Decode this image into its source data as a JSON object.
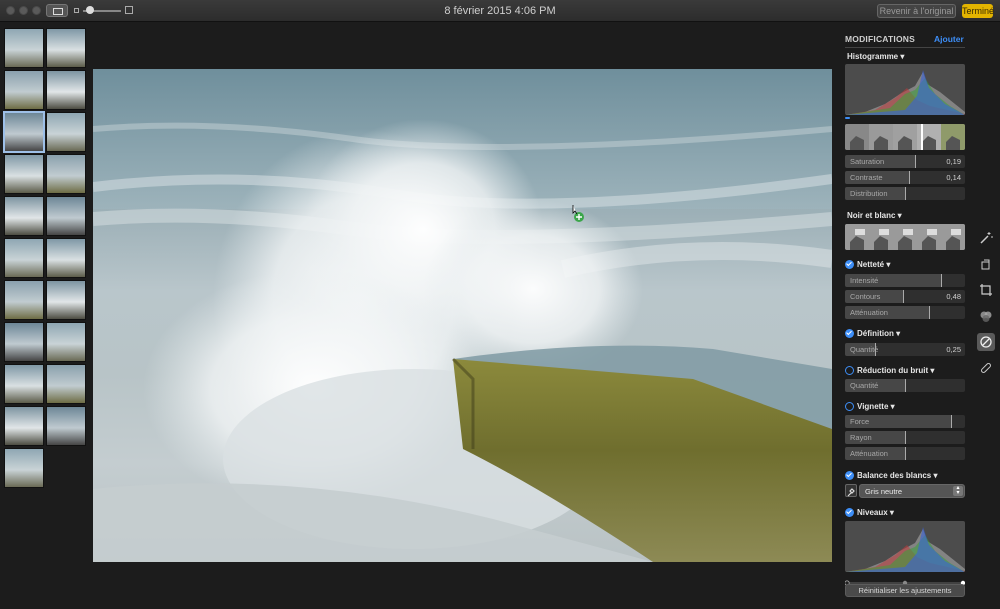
{
  "window": {
    "title": "8 février 2015 4:06 PM",
    "revert_label": "Revenir à l'original",
    "done_label": "Terminé",
    "colors": {
      "done": "#e3b400",
      "accent": "#3d8ef7"
    }
  },
  "toolbar_icons": [
    "view-toggle-icon",
    "zoom-small-icon",
    "zoom-large-icon"
  ],
  "zoom": {
    "level": 0.1
  },
  "thumbnails": {
    "count": 21,
    "selected_index": 4
  },
  "panel": {
    "header": "MODIFICATIONS",
    "add_label": "Ajouter",
    "histogram": {
      "title": "Histogramme ▾"
    },
    "light": {
      "sliders": [
        {
          "label": "Saturation",
          "value": "0,19",
          "level": 0.58
        },
        {
          "label": "Contraste",
          "value": "0,14",
          "level": 0.53
        },
        {
          "label": "Distribution",
          "value": "",
          "level": 0.5
        }
      ]
    },
    "black_white": {
      "title": "Noir et blanc ▾"
    },
    "sharpen": {
      "title": "Netteté ▾",
      "enabled": true,
      "sliders": [
        {
          "label": "Intensité",
          "value": "",
          "level": 0.8
        },
        {
          "label": "Contours",
          "value": "0,48",
          "level": 0.48
        },
        {
          "label": "Atténuation",
          "value": "",
          "level": 0.7
        }
      ]
    },
    "definition": {
      "title": "Définition ▾",
      "enabled": true,
      "sliders": [
        {
          "label": "Quantité",
          "value": "0,25",
          "level": 0.25
        }
      ]
    },
    "noise": {
      "title": "Réduction du bruit ▾",
      "enabled": false,
      "sliders": [
        {
          "label": "Quantité",
          "value": "",
          "level": 0.5
        }
      ]
    },
    "vignette": {
      "title": "Vignette ▾",
      "enabled": false,
      "sliders": [
        {
          "label": "Force",
          "value": "",
          "level": 0.88
        },
        {
          "label": "Rayon",
          "value": "",
          "level": 0.5
        },
        {
          "label": "Atténuation",
          "value": "",
          "level": 0.5
        }
      ]
    },
    "white_balance": {
      "title": "Balance des blancs ▾",
      "enabled": true,
      "mode": "Gris neutre"
    },
    "levels": {
      "title": "Niveaux ▾",
      "enabled": true
    },
    "reset_label": "Réinitialiser les ajustements"
  },
  "tools": [
    "magic-wand-icon",
    "rotate-icon",
    "crop-icon",
    "filters-icon",
    "adjust-icon",
    "retouch-icon"
  ],
  "selected_tool": "adjust-icon"
}
